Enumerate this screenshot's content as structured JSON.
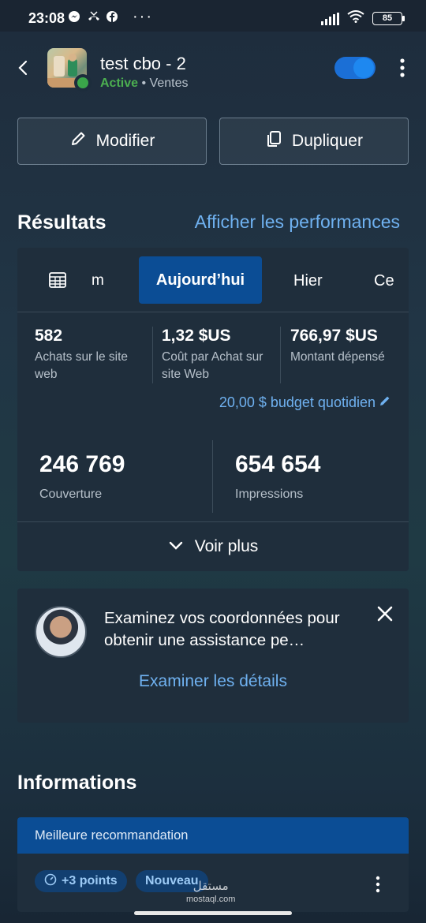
{
  "status_bar": {
    "time": "23:08",
    "more": "···",
    "battery": "85"
  },
  "campaign": {
    "title": "test cbo - 2",
    "status": "Active",
    "separator": " • ",
    "objective": "Ventes",
    "toggle_on": true
  },
  "actions": {
    "edit_label": "Modifier",
    "duplicate_label": "Dupliquer"
  },
  "results": {
    "title": "Résultats",
    "performance_link": "Afficher les performances",
    "tabs": {
      "custom": "m",
      "today": "Aujourd’hui",
      "yesterday": "Hier",
      "this": "Ce"
    },
    "metrics": [
      {
        "value": "582",
        "label": "Achats sur le site web"
      },
      {
        "value": "1,32 $US",
        "label": "Coût par Achat sur site Web"
      },
      {
        "value": "766,97 $US",
        "label": "Montant dépensé"
      }
    ],
    "budget": "20,00 $ budget quotidien",
    "big_metrics": [
      {
        "value": "246 769",
        "label": "Couverture"
      },
      {
        "value": "654 654",
        "label": "Impressions"
      }
    ],
    "see_more": "Voir plus"
  },
  "assistance": {
    "message": "Examinez vos coordonnées pour obtenir une assistance pe…",
    "link": "Examiner les détails"
  },
  "informations": {
    "title": "Informations",
    "recommendation_header": "Meilleure recommandation",
    "points_pill": "+3 points",
    "new_pill": "Nouveau"
  },
  "watermark": {
    "arabic": "مستقل",
    "latin": "mostaql.com"
  },
  "colors": {
    "accent": "#1e88f0",
    "link": "#6fb1f0",
    "active": "#4caf50",
    "tab_selected": "#0b4d95"
  }
}
